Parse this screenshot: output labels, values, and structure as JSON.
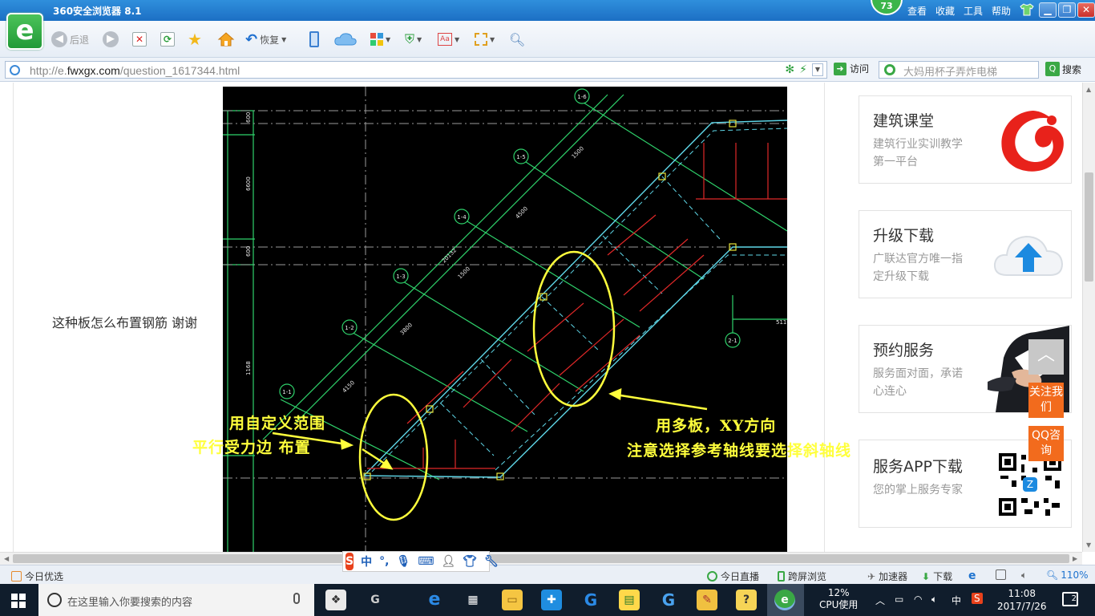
{
  "titlebar": {
    "title": "360安全浏览器 8.1",
    "badge": "73",
    "menu": [
      "查看",
      "收藏",
      "工具",
      "帮助"
    ]
  },
  "toolbar": {
    "back_label": "后退",
    "restore_label": "恢复"
  },
  "address": {
    "url_prefix": "http://e.",
    "url_domain": "fwxgx.com",
    "url_path": "/question_1617344.html",
    "go_label": "访问",
    "search_placeholder": "大妈用杯子弄炸电梯",
    "search_label": "搜索"
  },
  "content": {
    "question": "这种板怎么布置钢筋   谢谢",
    "annotations": {
      "left_line1": "用自定义范围",
      "left_line2": "平行受力边 布置",
      "right_line1": "用多板，XY方向",
      "right_line2": "注意选择参考轴线要选择斜轴线"
    },
    "cad_axes": [
      "1-6",
      "1-5",
      "1-4",
      "1-3",
      "1-2",
      "1-1",
      "2-1"
    ],
    "cad_dims": [
      "600",
      "6600",
      "600",
      "1168",
      "1500",
      "4500",
      "1500",
      "20132",
      "3800",
      "4150",
      "5110"
    ]
  },
  "sidebar": {
    "cards": [
      {
        "title": "建筑课堂",
        "sub": "建筑行业实训教学第一平台"
      },
      {
        "title": "升级下载",
        "sub": "广联达官方唯一指定升级下载"
      },
      {
        "title": "预约服务",
        "sub": "服务面对面，承诺心连心"
      },
      {
        "title": "服务APP下载",
        "sub": "您的掌上服务专家"
      }
    ],
    "follow_label": "关注我们",
    "qq_label": "QQ咨询"
  },
  "statusbar": {
    "left": "今日优选",
    "live": "今日直播",
    "cross_screen": "跨屏浏览",
    "accelerator": "加速器",
    "download": "下载",
    "zoom": "110%"
  },
  "ime": {
    "mode": "中"
  },
  "taskbar": {
    "search_placeholder": "在这里输入你要搜索的内容",
    "cpu_percent": "12%",
    "cpu_label": "CPU使用",
    "input_lang": "中",
    "time": "11:08",
    "date": "2017/7/26",
    "notifications": "2"
  },
  "colors": {
    "accent_green": "#3aa845",
    "annotation_yellow": "#ffff3c",
    "float_orange": "#f26b1d",
    "titlebar_blue": "#1c6fc4"
  }
}
